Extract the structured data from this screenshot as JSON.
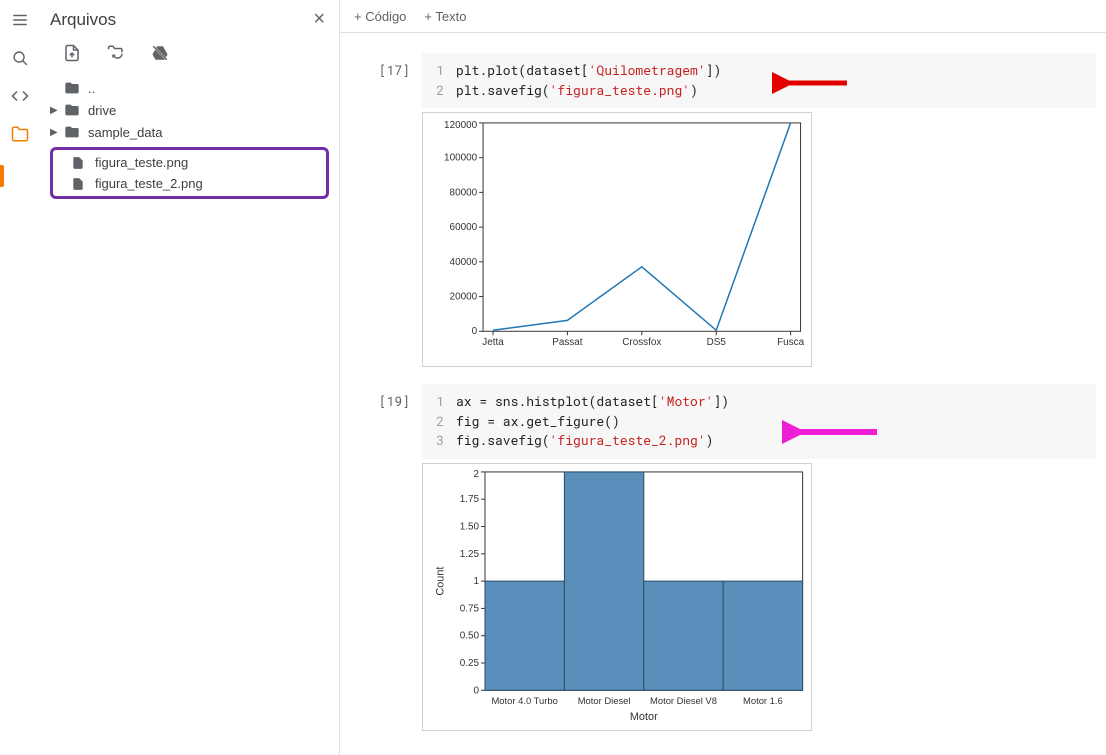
{
  "left_rail": {
    "icons": [
      "menu",
      "search",
      "code",
      "folder"
    ]
  },
  "file_panel": {
    "title": "Arquivos",
    "toolbar_icons": [
      "file-upload",
      "folder-sync",
      "drive-disabled"
    ],
    "tree": {
      "updir": "..",
      "drive": "drive",
      "sample_data": "sample_data",
      "highlighted": [
        "figura_teste.png",
        "figura_teste_2.png"
      ]
    }
  },
  "main_toolbar": {
    "code_btn": "+  Código",
    "text_btn": "+  Texto"
  },
  "cells": [
    {
      "exec_count": "[17]",
      "code": {
        "line1_prefix": "plt.plot(dataset[",
        "line1_str": "'Quilometragem'",
        "line1_suffix": "])",
        "line2_prefix": "plt.savefig(",
        "line2_str": "'figura_teste.png'",
        "line2_suffix": ")"
      }
    },
    {
      "exec_count": "[19]",
      "code": {
        "line1_prefix": "ax = sns.histplot(dataset[",
        "line1_str": "'Motor'",
        "line1_suffix": "])",
        "line2": "fig = ax.get_figure()",
        "line3_prefix": "fig.savefig(",
        "line3_str": "'figura_teste_2.png'",
        "line3_suffix": ")"
      }
    }
  ],
  "chart_data": [
    {
      "type": "line",
      "categories": [
        "Jetta",
        "Passat",
        "Crossfox",
        "DS5",
        "Fusca"
      ],
      "values": [
        500,
        6000,
        37000,
        500,
        120000
      ],
      "title": "",
      "xlabel": "",
      "ylabel": "",
      "ylim": [
        0,
        120000
      ],
      "yticks": [
        0,
        20000,
        40000,
        60000,
        80000,
        100000,
        120000
      ]
    },
    {
      "type": "bar",
      "categories": [
        "Motor 4.0 Turbo",
        "Motor Diesel",
        "Motor Diesel V8",
        "Motor 1.6"
      ],
      "values": [
        1,
        2,
        1,
        1
      ],
      "title": "",
      "xlabel": "Motor",
      "ylabel": "Count",
      "ylim": [
        0,
        2.0
      ],
      "yticks": [
        0.0,
        0.25,
        0.5,
        0.75,
        1.0,
        1.25,
        1.5,
        1.75,
        2.0
      ]
    }
  ],
  "annotations": {
    "arrow_red_target": "figura_teste.png savefig",
    "arrow_magenta_target": "figura_teste_2.png savefig"
  }
}
